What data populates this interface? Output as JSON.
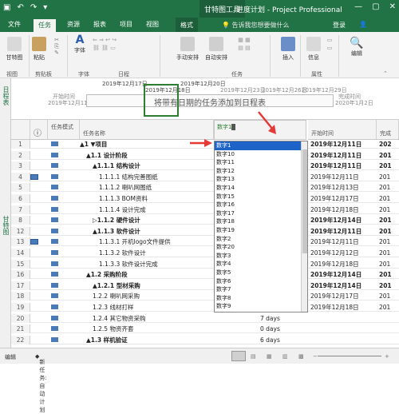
{
  "titlebar": {
    "context_tab": "甘特图工具",
    "title": "进度计划 - Project Professional",
    "win_minimize": "—",
    "win_restore": "▢",
    "win_close": "✕"
  },
  "tabs": {
    "file": "文件",
    "task": "任务",
    "resource": "资源",
    "report": "报表",
    "project": "项目",
    "view": "视图",
    "format": "格式",
    "tell_me": "告诉我您想要做什么",
    "login": "登录"
  },
  "ribbon": {
    "gantt": "甘特图",
    "paste": "粘贴",
    "font": "字体",
    "manual_schedule": "手动安排",
    "auto_schedule": "自动安排",
    "insert": "插入",
    "info": "信息",
    "edit": "编辑",
    "groups": {
      "view": "视图",
      "clipboard": "剪贴板",
      "font": "字体",
      "schedule": "日程",
      "tasks": "任务",
      "properties": "属性"
    }
  },
  "timeline": {
    "side_label": "日程表",
    "start_label": "开始时间",
    "start_date": "2019年12月11日",
    "end_label": "完成时间",
    "end_date": "2020年1月2日",
    "dates": [
      "2019年12月17日",
      "2019年12月20日",
      "2019年12月23日",
      "2019年12月26日",
      "2019年12月29日"
    ],
    "highlight_date": "2019年12月18日",
    "placeholder": "将带有日期的任务添加到日程表"
  },
  "grid": {
    "side_label": "甘特图",
    "headers": {
      "info": "ⓘ",
      "mode": "任务模式",
      "name": "任务名称",
      "start": "开始时间",
      "finish": "完成"
    },
    "rows": [
      {
        "n": "1",
        "name": "▲1 ▼项目",
        "dur": "",
        "start": "2019年12月11日",
        "fin": "202"
      },
      {
        "n": "2",
        "name": "▲1.1 设计阶段",
        "dur": "",
        "start": "2019年12月11日",
        "fin": "201"
      },
      {
        "n": "3",
        "name": "▲1.1.1 结构设计",
        "dur": "",
        "start": "2019年12月11日",
        "fin": "201"
      },
      {
        "n": "4",
        "name": "1.1.1.1 结构完善图纸",
        "dur": "",
        "start": "2019年12月11日",
        "fin": "201"
      },
      {
        "n": "5",
        "name": "1.1.1.2 喇叭网图纸",
        "dur": "",
        "start": "2019年12月13日",
        "fin": "201"
      },
      {
        "n": "6",
        "name": "1.1.1.3 BOM资料",
        "dur": "",
        "start": "2019年12月17日",
        "fin": "201"
      },
      {
        "n": "7",
        "name": "1.1.1.4 设计完成",
        "dur": "",
        "start": "2019年12月18日",
        "fin": "201"
      },
      {
        "n": "8",
        "name": "▷1.1.2 硬件设计",
        "dur": "",
        "start": "2019年12月14日",
        "fin": "201"
      },
      {
        "n": "12",
        "name": "▲1.1.3 软件设计",
        "dur": "",
        "start": "2019年12月11日",
        "fin": "201"
      },
      {
        "n": "13",
        "name": "1.1.3.1 开机logo文件提供",
        "dur": "",
        "start": "2019年12月11日",
        "fin": "201"
      },
      {
        "n": "14",
        "name": "1.1.3.2 软件设计",
        "dur": "",
        "start": "2019年12月12日",
        "fin": "201"
      },
      {
        "n": "15",
        "name": "1.1.3.3 软件设计完成",
        "dur": "",
        "start": "2019年12月18日",
        "fin": "201"
      },
      {
        "n": "16",
        "name": "▲1.2 采购阶段",
        "dur": "",
        "start": "2019年12月14日",
        "fin": "201"
      },
      {
        "n": "17",
        "name": "▲1.2.1 型材采购",
        "dur": "",
        "start": "2019年12月14日",
        "fin": "201"
      },
      {
        "n": "18",
        "name": "1.2.2 喇叭网采购",
        "dur": "",
        "start": "2019年12月17日",
        "fin": "201"
      },
      {
        "n": "19",
        "name": "1.2.3 线材打样",
        "dur": "",
        "start": "2019年12月18日",
        "fin": "201"
      },
      {
        "n": "20",
        "name": "1.2.4 其它物资采购",
        "dur": "7 days",
        "start": "",
        "fin": ""
      },
      {
        "n": "21",
        "name": "1.2.5 物资齐套",
        "dur": "0 days",
        "start": "",
        "fin": ""
      },
      {
        "n": "22",
        "name": "▲1.3 样机验证",
        "dur": "6 days",
        "start": "",
        "fin": ""
      }
    ]
  },
  "dropdown": {
    "header": "数字1",
    "items": [
      "数字1",
      "数字10",
      "数字11",
      "数字12",
      "数字13",
      "数字14",
      "数字15",
      "数字16",
      "数字17",
      "数字18",
      "数字19",
      "数字2",
      "数字20",
      "数字3",
      "数字4",
      "数字5",
      "数字6",
      "数字7",
      "数字8",
      "数字9"
    ]
  },
  "status": {
    "edit": "编辑",
    "new_task": "新任务: 自动计划"
  },
  "colors": {
    "accent": "#217346",
    "selection": "#1e64c8",
    "arrow": "#e53935"
  }
}
